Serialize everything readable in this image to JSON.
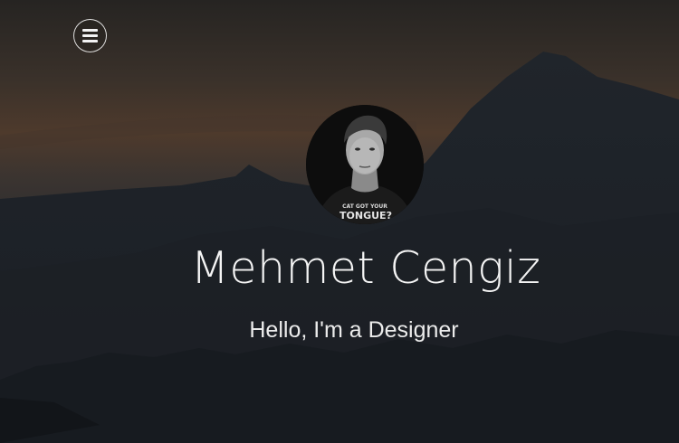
{
  "header": {
    "menu_icon": "hamburger-menu-icon"
  },
  "profile": {
    "name": "Mehmet Cengiz",
    "tagline": "Hello, I'm a Designer",
    "avatar_shirt_text_line1": "CAT GOT YOUR",
    "avatar_shirt_text_line2": "TONGUE?"
  },
  "colors": {
    "sky_top": "#2a2622",
    "sky_glow": "#5a4030",
    "mountain": "#1e2329",
    "foreground": "#161a1f",
    "text": "#f4f4f4"
  }
}
